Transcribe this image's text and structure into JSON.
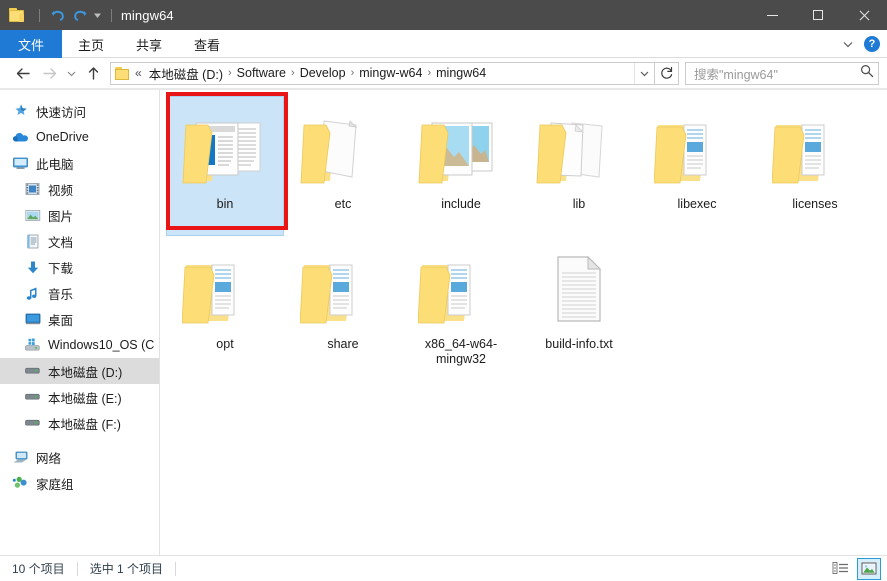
{
  "window": {
    "title": "mingw64",
    "qat": {
      "folder_icon": "folder-icon",
      "undo_label": "撤消",
      "redo_label": "重做",
      "customize_label": "自定义快速访问工具栏"
    },
    "controls": {
      "minimize": "最小化",
      "maximize": "最大化",
      "close": "关闭"
    }
  },
  "ribbon": {
    "tabs": [
      {
        "label": "文件",
        "active": true
      },
      {
        "label": "主页",
        "active": false
      },
      {
        "label": "共享",
        "active": false
      },
      {
        "label": "查看",
        "active": false
      }
    ],
    "expand_label": "展开功能区",
    "help_label": "?"
  },
  "address": {
    "back_label": "后退",
    "forward_label": "前进",
    "recent_label": "最近浏览的位置",
    "up_label": "上一级",
    "overflow": "«",
    "crumbs": [
      "本地磁盘 (D:)",
      "Software",
      "Develop",
      "mingw-w64",
      "mingw64"
    ],
    "separator": "›",
    "dropdown_label": "以前的位置",
    "refresh_label": "刷新"
  },
  "search": {
    "placeholder": "搜索\"mingw64\"",
    "icon": "search-icon"
  },
  "sidebar": {
    "items": [
      {
        "label": "快速访问",
        "icon": "star-pin-icon",
        "indent": false,
        "selected": false
      },
      {
        "label": "OneDrive",
        "icon": "cloud-icon",
        "indent": false,
        "selected": false
      },
      {
        "label": "此电脑",
        "icon": "monitor-icon",
        "indent": false,
        "selected": false
      },
      {
        "label": "视频",
        "icon": "video-icon",
        "indent": true,
        "selected": false
      },
      {
        "label": "图片",
        "icon": "picture-icon",
        "indent": true,
        "selected": false
      },
      {
        "label": "文档",
        "icon": "document-icon",
        "indent": true,
        "selected": false
      },
      {
        "label": "下载",
        "icon": "download-icon",
        "indent": true,
        "selected": false
      },
      {
        "label": "音乐",
        "icon": "music-icon",
        "indent": true,
        "selected": false
      },
      {
        "label": "桌面",
        "icon": "desktop-icon",
        "indent": true,
        "selected": false
      },
      {
        "label": "Windows10_OS (C",
        "icon": "windows-drive-icon",
        "indent": true,
        "selected": false
      },
      {
        "label": "本地磁盘 (D:)",
        "icon": "drive-icon",
        "indent": true,
        "selected": true
      },
      {
        "label": "本地磁盘 (E:)",
        "icon": "drive-icon",
        "indent": true,
        "selected": false
      },
      {
        "label": "本地磁盘 (F:)",
        "icon": "drive-icon",
        "indent": true,
        "selected": false
      },
      {
        "label": "网络",
        "icon": "network-icon",
        "indent": false,
        "selected": false
      },
      {
        "label": "家庭组",
        "icon": "homegroup-icon",
        "indent": false,
        "selected": false
      }
    ]
  },
  "files": [
    {
      "name": "bin",
      "type": "folder-code",
      "selected": true,
      "annotated": true
    },
    {
      "name": "etc",
      "type": "folder-doc",
      "selected": false,
      "annotated": false
    },
    {
      "name": "include",
      "type": "folder-image",
      "selected": false,
      "annotated": false
    },
    {
      "name": "lib",
      "type": "folder-plain",
      "selected": false,
      "annotated": false
    },
    {
      "name": "libexec",
      "type": "folder-mixed",
      "selected": false,
      "annotated": false
    },
    {
      "name": "licenses",
      "type": "folder-mixed",
      "selected": false,
      "annotated": false
    },
    {
      "name": "opt",
      "type": "folder-mixed",
      "selected": false,
      "annotated": false
    },
    {
      "name": "share",
      "type": "folder-mixed",
      "selected": false,
      "annotated": false
    },
    {
      "name": "x86_64-w64-mingw32",
      "type": "folder-mixed",
      "selected": false,
      "annotated": false
    },
    {
      "name": "build-info.txt",
      "type": "textfile",
      "selected": false,
      "annotated": false
    }
  ],
  "status": {
    "item_count": "10 个项目",
    "selection": "选中 1 个项目",
    "details_view_label": "详细信息",
    "icons_view_label": "大图标"
  },
  "colors": {
    "titlebar": "#4b4b4b",
    "accent": "#1e7ad4",
    "selection_bg": "#cce4f7",
    "selection_border": "#a8d2f0",
    "annotation": "#e81416",
    "folder_yellow": "#fcdd76",
    "nav_selected": "#dcdcdc"
  }
}
